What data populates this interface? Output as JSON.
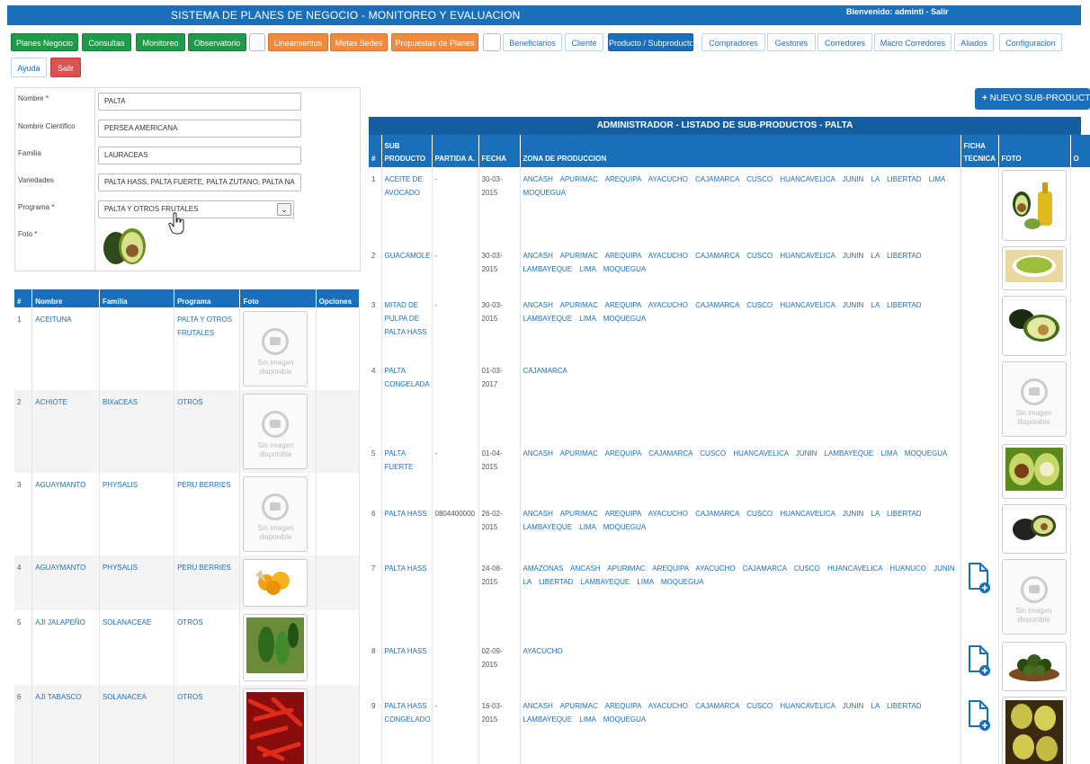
{
  "header": {
    "title": "SISTEMA DE PLANES DE NEGOCIO - MONITOREO Y EVALUACION",
    "welcome": "Bienvenido: adminti - Salir"
  },
  "nav": {
    "row1": [
      {
        "label": "Planes Negocio",
        "style": "green"
      },
      {
        "label": "Consultas",
        "style": "green"
      },
      {
        "label": "Monitoreo",
        "style": "green"
      },
      {
        "label": "Observatorio",
        "style": "green"
      },
      {
        "label": "",
        "style": "blank"
      },
      {
        "label": "Lineamientos",
        "style": "orange"
      },
      {
        "label": "Metas Sedes",
        "style": "orange"
      },
      {
        "label": "Propuestas de Planes",
        "style": "orange"
      },
      {
        "label": "",
        "style": "blank"
      },
      {
        "label": "Beneficiarios",
        "style": "light"
      },
      {
        "label": "Cliente",
        "style": "light"
      },
      {
        "label": "Producto / Subproducto",
        "style": "active"
      },
      {
        "label": "Compradores",
        "style": "light"
      },
      {
        "label": "Gestores",
        "style": "light"
      },
      {
        "label": "Corredores",
        "style": "light"
      },
      {
        "label": "Macro Corredores",
        "style": "light"
      },
      {
        "label": "Aliados",
        "style": "light"
      },
      {
        "label": "Configuracion",
        "style": "light"
      }
    ],
    "row2": [
      {
        "label": "Ayuda",
        "style": "light"
      },
      {
        "label": "Salir",
        "style": "red"
      }
    ]
  },
  "form": {
    "nombre_label": "Nombre",
    "nombre_value": "PALTA",
    "cientifico_label": "Nombre Cientifico",
    "cientifico_value": "PERSEA AMERICANA",
    "familia_label": "Familia",
    "familia_value": "LAURACEAS",
    "variedades_label": "Variedades",
    "variedades_value": "PALTA HASS, PALTA FUERTE, PALTA ZUTANO, PALTA NA",
    "programa_label": "Programa",
    "programa_value": "PALTA Y OTROS FRUTALES",
    "foto_label": "Foto",
    "required_mark": "*"
  },
  "left_table": {
    "headers": [
      "#",
      "Nombre",
      "Familia",
      "Programa",
      "Foto",
      "Opciones"
    ],
    "no_image": [
      "Sin imagen",
      "disponible"
    ],
    "rows": [
      {
        "n": "1",
        "nombre": "ACEITUNA",
        "familia": "",
        "programa": "PALTA Y OTROS FRUTALES",
        "foto": "none"
      },
      {
        "n": "2",
        "nombre": "ACHIOTE",
        "familia": "BIXaCEAS",
        "programa": "OTROS",
        "foto": "none"
      },
      {
        "n": "3",
        "nombre": "AGUAYMANTO",
        "familia": "PHYSALIS",
        "programa": "PERU BERRIES",
        "foto": "none"
      },
      {
        "n": "4",
        "nombre": "AGUAYMANTO",
        "familia": "PHYSALIS",
        "programa": "PERU BERRIES",
        "foto": "berries"
      },
      {
        "n": "5",
        "nombre": "AJI JALAPEÑO",
        "familia": "SOLANACEAE",
        "programa": "OTROS",
        "foto": "jalapeno"
      },
      {
        "n": "6",
        "nombre": "AJI TABASCO",
        "familia": "SOLANACEA",
        "programa": "OTROS",
        "foto": "tabasco"
      }
    ]
  },
  "right_panel": {
    "new_button": "NUEVO SUB-PRODUCTO",
    "title": "ADMINISTRADOR - LISTADO DE SUB-PRODUCTOS - PALTA",
    "headers": [
      "#",
      "SUB PRODUCTO",
      "PARTIDA A.",
      "FECHA",
      "ZONA DE PRODUCCION",
      "FICHA TECNICA",
      "FOTO",
      "O"
    ],
    "rows": [
      {
        "n": "1",
        "sub": "ACEITE DE AVOCADO",
        "partida": "-",
        "fecha": "30-03-2015",
        "zona": "ANCASH APURIMAC AREQUIPA AYACUCHO CAJAMARCA CUSCO HUANCAVELICA JUNIN LA LIBERTAD LIMA MOQUEGUA",
        "ficha": false,
        "foto": "oil"
      },
      {
        "n": "2",
        "sub": "GUACAMOLE",
        "partida": "-",
        "fecha": "30-03-2015",
        "zona": "ANCASH APURIMAC AREQUIPA AYACUCHO CAJAMARCA CUSCO HUANCAVELICA JUNIN LA LIBERTAD LAMBAYEQUE LIMA MOQUEGUA",
        "ficha": false,
        "foto": "guac"
      },
      {
        "n": "3",
        "sub": "MITAD DE PULPA DE PALTA HASS",
        "partida": "-",
        "fecha": "30-03-2015",
        "zona": "ANCASH APURIMAC AREQUIPA AYACUCHO CAJAMARCA CUSCO HUANCAVELICA JUNIN LA LIBERTAD LAMBAYEQUE LIMA MOQUEGUA",
        "ficha": false,
        "foto": "half"
      },
      {
        "n": "4",
        "sub": "PALTA CONGELADA",
        "partida": "",
        "fecha": "01-03-2017",
        "zona": "CAJAMARCA",
        "ficha": false,
        "foto": "none"
      },
      {
        "n": "5",
        "sub": "PALTA FUERTE",
        "partida": "-",
        "fecha": "01-04-2015",
        "zona": "ANCASH APURIMAC AREQUIPA CAJAMARCA CUSCO HUANCAVELICA JUNIN LAMBAYEQUE LIMA MOQUEGUA",
        "ficha": false,
        "foto": "halves"
      },
      {
        "n": "6",
        "sub": "PALTA HASS",
        "partida": "0804400000",
        "fecha": "26-02-2015",
        "zona": "ANCASH APURIMAC AREQUIPA AYACUCHO CAJAMARCA CUSCO HUANCAVELICA JUNIN LA LIBERTAD LAMBAYEQUE LIMA MOQUEGUA",
        "ficha": false,
        "foto": "hass"
      },
      {
        "n": "7",
        "sub": "PALTA HASS",
        "partida": "",
        "fecha": "24-08-2015",
        "zona": "AMAZONAS ANCASH APURIMAC AREQUIPA AYACUCHO CAJAMARCA CUSCO HUANCAVELICA HUANUCO JUNIN LA LIBERTAD LAMBAYEQUE LIMA MOQUEGUA",
        "ficha": true,
        "foto": "none"
      },
      {
        "n": "8",
        "sub": "PALTA HASS",
        "partida": "",
        "fecha": "02-09-2015",
        "zona": "AYACUCHO",
        "ficha": true,
        "foto": "basket"
      },
      {
        "n": "9",
        "sub": "PALTA HASS CONGELADO",
        "partida": "-",
        "fecha": "16-03-2015",
        "zona": "ANCASH APURIMAC AREQUIPA AYACUCHO CAJAMARCA CUSCO HUANCAVELICA JUNIN LA LIBERTAD LAMBAYEQUE LIMA MOQUEGUA",
        "ficha": true,
        "foto": "frozen"
      }
    ]
  },
  "colors": {
    "primary": "#1a6fba",
    "green": "#1e9a48",
    "orange": "#f08a3c",
    "red": "#d9534f"
  }
}
